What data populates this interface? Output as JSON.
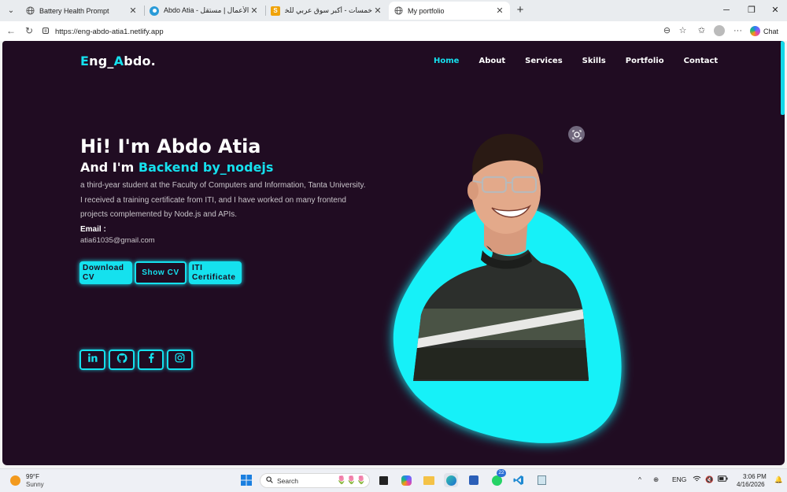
{
  "browser": {
    "tabs": [
      {
        "title": "Battery Health Prompt",
        "active": false
      },
      {
        "title": "Abdo Atia - معرض الأعمال | مستقل",
        "active": false
      },
      {
        "title": "خمسات - أكبر سوق عربي للخدمات ال",
        "active": false
      },
      {
        "title": "My portfolio",
        "active": true
      }
    ],
    "url": "https://eng-abdo-atia1.netlify.app",
    "chat_label": "Chat"
  },
  "site": {
    "logo_part1": "E",
    "logo_part2": "ng_",
    "logo_part3": "A",
    "logo_part4": "bdo.",
    "nav": [
      "Home",
      "About",
      "Services",
      "Skills",
      "Portfolio",
      "Contact"
    ],
    "active_nav": "Home",
    "hero_title": "Hi! I'm Abdo Atia",
    "hero_subtitle_prefix": "And I'm",
    "hero_subtitle_role": "Backend by_nodejs",
    "hero_description": "a third-year student at the Faculty of Computers and Information, Tanta University. I received a training certificate from ITI, and I have worked on many frontend projects complemented by Node.js and APIs.",
    "email_label": "Email :",
    "email_value": "atia61035@gmail.com",
    "buttons": {
      "download_cv": "Download CV",
      "show_cv": "Show CV",
      "iti_certificate": "ITI Certificate"
    },
    "social_icons": [
      "linkedin-icon",
      "github-icon",
      "facebook-icon",
      "instagram-icon"
    ],
    "accent_color": "#15e1ee",
    "background_color": "#200c22"
  },
  "taskbar": {
    "weather_temp": "99°F",
    "weather_desc": "Sunny",
    "search_placeholder": "Search",
    "whatsapp_badge": "22",
    "language": "ENG",
    "time": "3:06 PM",
    "date": "4/16/2026"
  }
}
